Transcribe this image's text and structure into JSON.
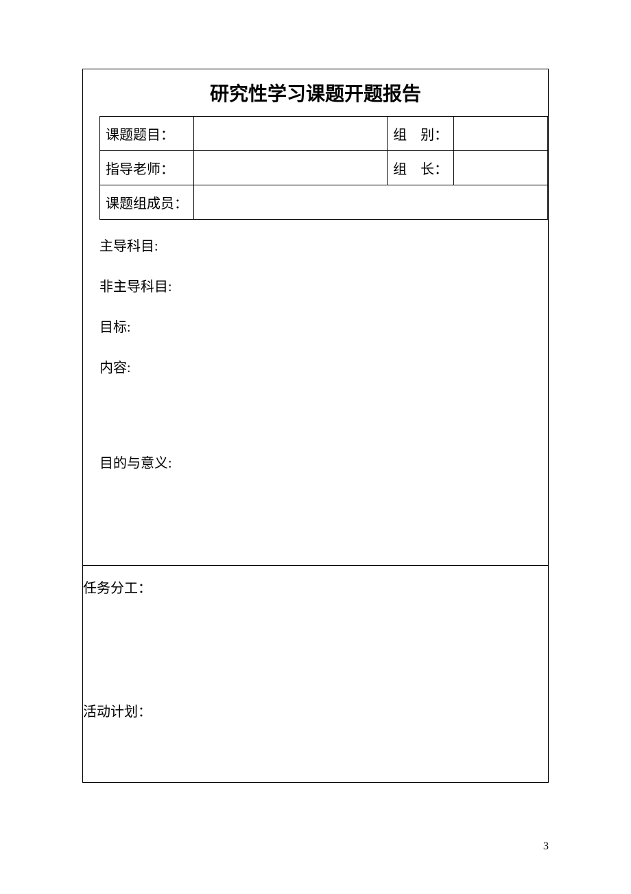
{
  "title": "研究性学习课题开题报告",
  "form": {
    "topic_label": "课题题目：",
    "topic_value": "",
    "group_label": "组　别：",
    "group_value": "",
    "teacher_label": "指导老师：",
    "teacher_value": "",
    "leader_label": "组　长：",
    "leader_value": "",
    "members_label": "课题组成员：",
    "members_value": ""
  },
  "sections": {
    "main_subject_label": "主导科目:",
    "non_main_subject_label": "非主导科目:",
    "goal_label": "目标:",
    "content_label": "内容:",
    "purpose_label": "目的与意义:",
    "task_label": "任务分工：",
    "plan_label": "活动计划："
  },
  "page_number": "3"
}
